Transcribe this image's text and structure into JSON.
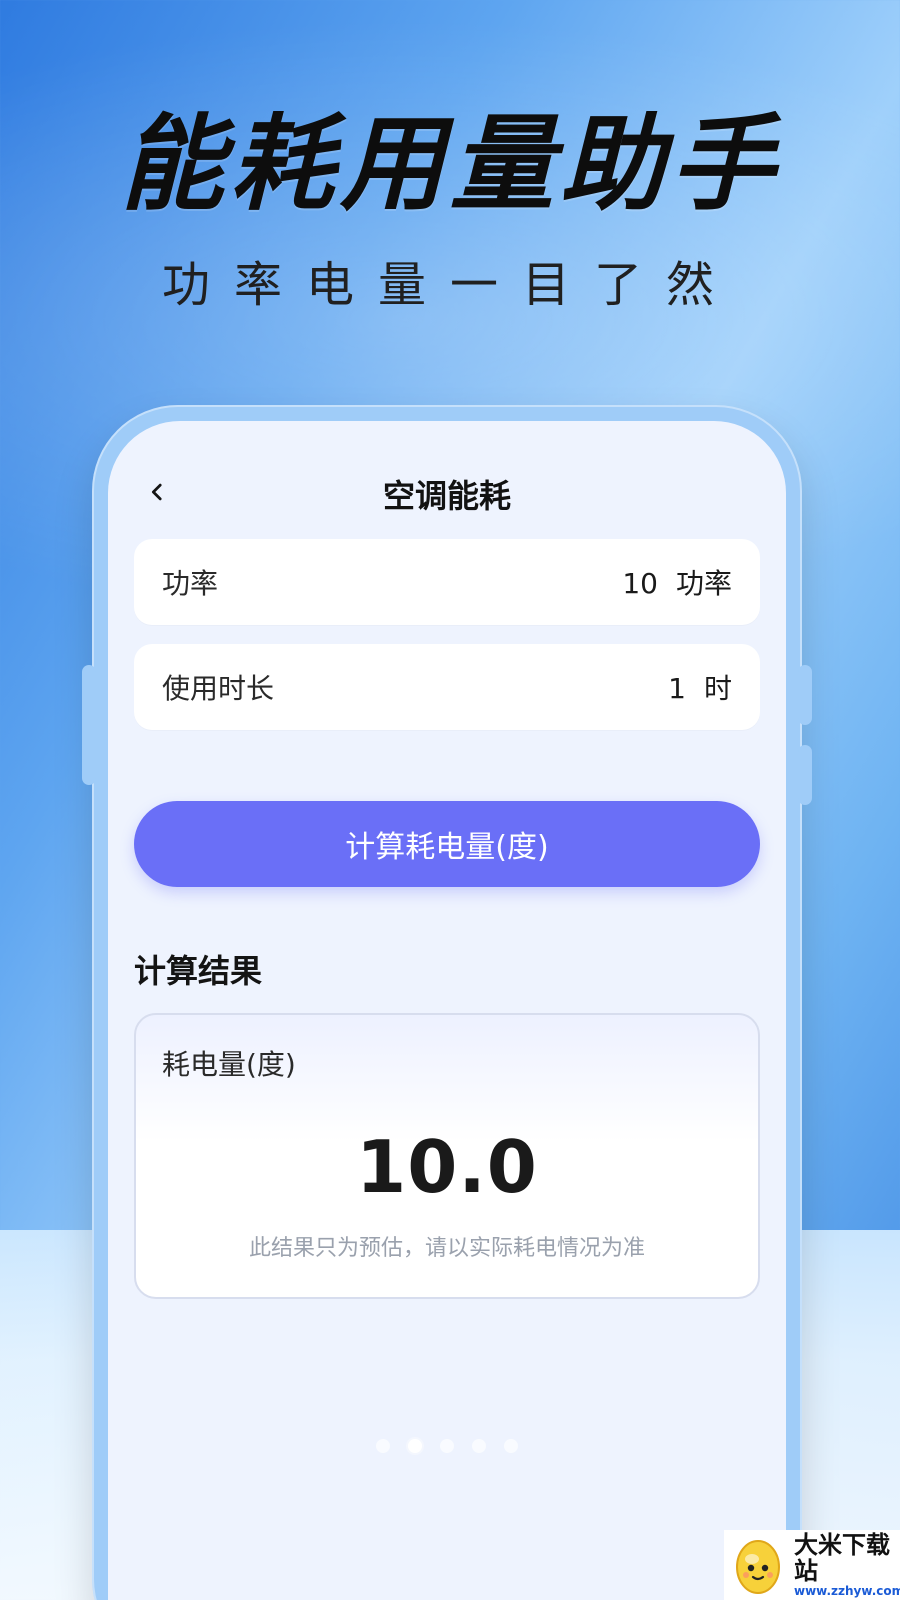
{
  "hero": {
    "title": "能耗用量助手",
    "subtitle": "功率电量一目了然"
  },
  "screen": {
    "nav": {
      "back_icon": "chevron-left-icon",
      "title": "空调能耗"
    },
    "fields": [
      {
        "label": "功率",
        "value": "10",
        "unit": "功率"
      },
      {
        "label": "使用时长",
        "value": "1",
        "unit": "时"
      }
    ],
    "calculate_button": {
      "label": "计算耗电量(度)"
    },
    "result_section": {
      "title": "计算结果",
      "label": "耗电量(度)",
      "value": "10.0",
      "note": "此结果只为预估，请以实际耗电情况为准"
    },
    "pager": {
      "count": 5,
      "active_index": 1
    }
  },
  "watermark": {
    "title": "大米下载站",
    "url": "www.zzhyw.com"
  },
  "colors": {
    "accent": "#6a6ff7",
    "screen_bg": "#eef3fe",
    "phone_frame": "#9fccf8"
  }
}
